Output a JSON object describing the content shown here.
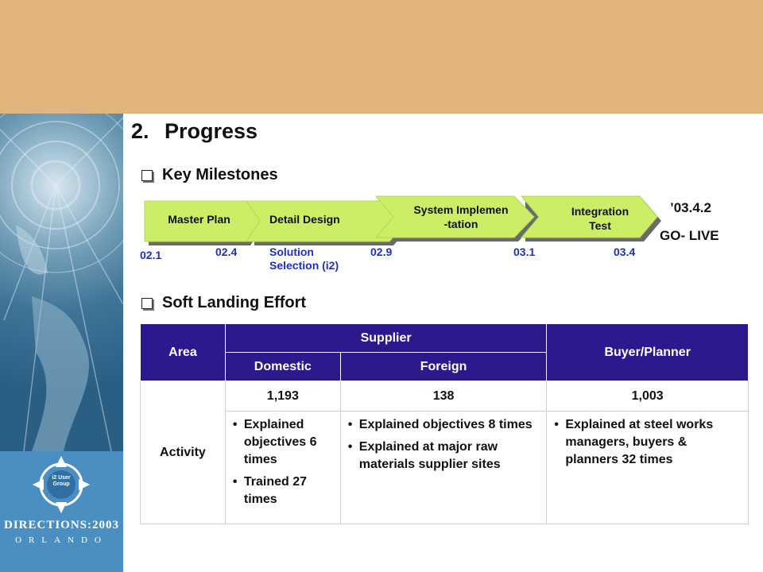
{
  "title": {
    "number": "2.",
    "text": "Progress"
  },
  "sections": {
    "milestones": "Key Milestones",
    "soft_landing": "Soft Landing Effort"
  },
  "milestones": {
    "phases": [
      "Master Plan",
      "Detail Design",
      "System Implemen\n-tation",
      "Integration\nTest"
    ],
    "dates": [
      "02.1",
      "02.4",
      "02.9",
      "03.1",
      "03.4"
    ],
    "note": "Solution\nSelection (i2)",
    "golive_date": "’03.4.2",
    "golive_label": "GO- LIVE"
  },
  "table": {
    "headers": {
      "area": "Area",
      "supplier": "Supplier",
      "buyer": "Buyer/Planner",
      "domestic": "Domestic",
      "foreign": "Foreign"
    },
    "row_label": "Activity",
    "counts": {
      "domestic": "1,193",
      "foreign": "138",
      "buyer": "1,003"
    },
    "details": {
      "domestic": [
        "Explained objectives 6 times",
        "Trained 27 times"
      ],
      "foreign": [
        "Explained objectives 8 times",
        "Explained at major raw materials supplier sites"
      ],
      "buyer": [
        "Explained at steel works managers, buyers & planners 32 times"
      ]
    }
  },
  "logo": {
    "badge": "i2 User Group",
    "event": "DIRECTIONS:2003",
    "city": "ORLANDO"
  },
  "colors": {
    "top_band": "#e1b57b",
    "arrow": "#ccee66",
    "header": "#2b1a8e",
    "date_blue": "#1f2fbf"
  }
}
